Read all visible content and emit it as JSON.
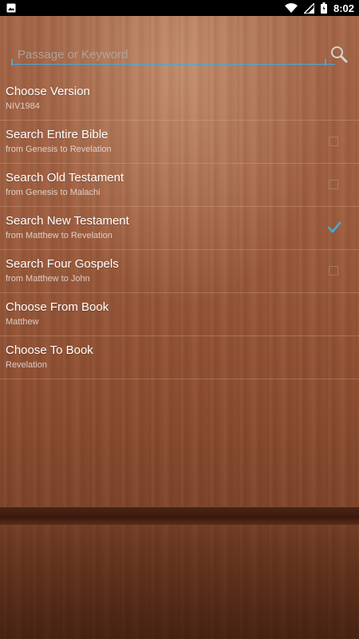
{
  "status_bar": {
    "time": "8:02",
    "icons": [
      "image-icon",
      "wifi-icon",
      "signal-icon",
      "battery-icon"
    ]
  },
  "search": {
    "placeholder": "Passage or Keyword",
    "value": ""
  },
  "options": [
    {
      "title": "Choose Version",
      "subtitle": "NIV1984"
    },
    {
      "title": "Search Entire Bible",
      "subtitle": "from Genesis to Revelation",
      "checked": false
    },
    {
      "title": "Search Old Testament",
      "subtitle": "from Genesis to Malachi",
      "checked": false
    },
    {
      "title": "Search New Testament",
      "subtitle": "from Matthew to Revelation",
      "checked": true
    },
    {
      "title": "Search Four Gospels",
      "subtitle": "from Matthew to John",
      "checked": false
    },
    {
      "title": "Choose From Book",
      "subtitle": "Matthew"
    },
    {
      "title": "Choose To Book",
      "subtitle": "Revelation"
    }
  ],
  "colors": {
    "accent": "#4aa8d8",
    "wood": "#a05f40",
    "status_bar": "#000000"
  }
}
